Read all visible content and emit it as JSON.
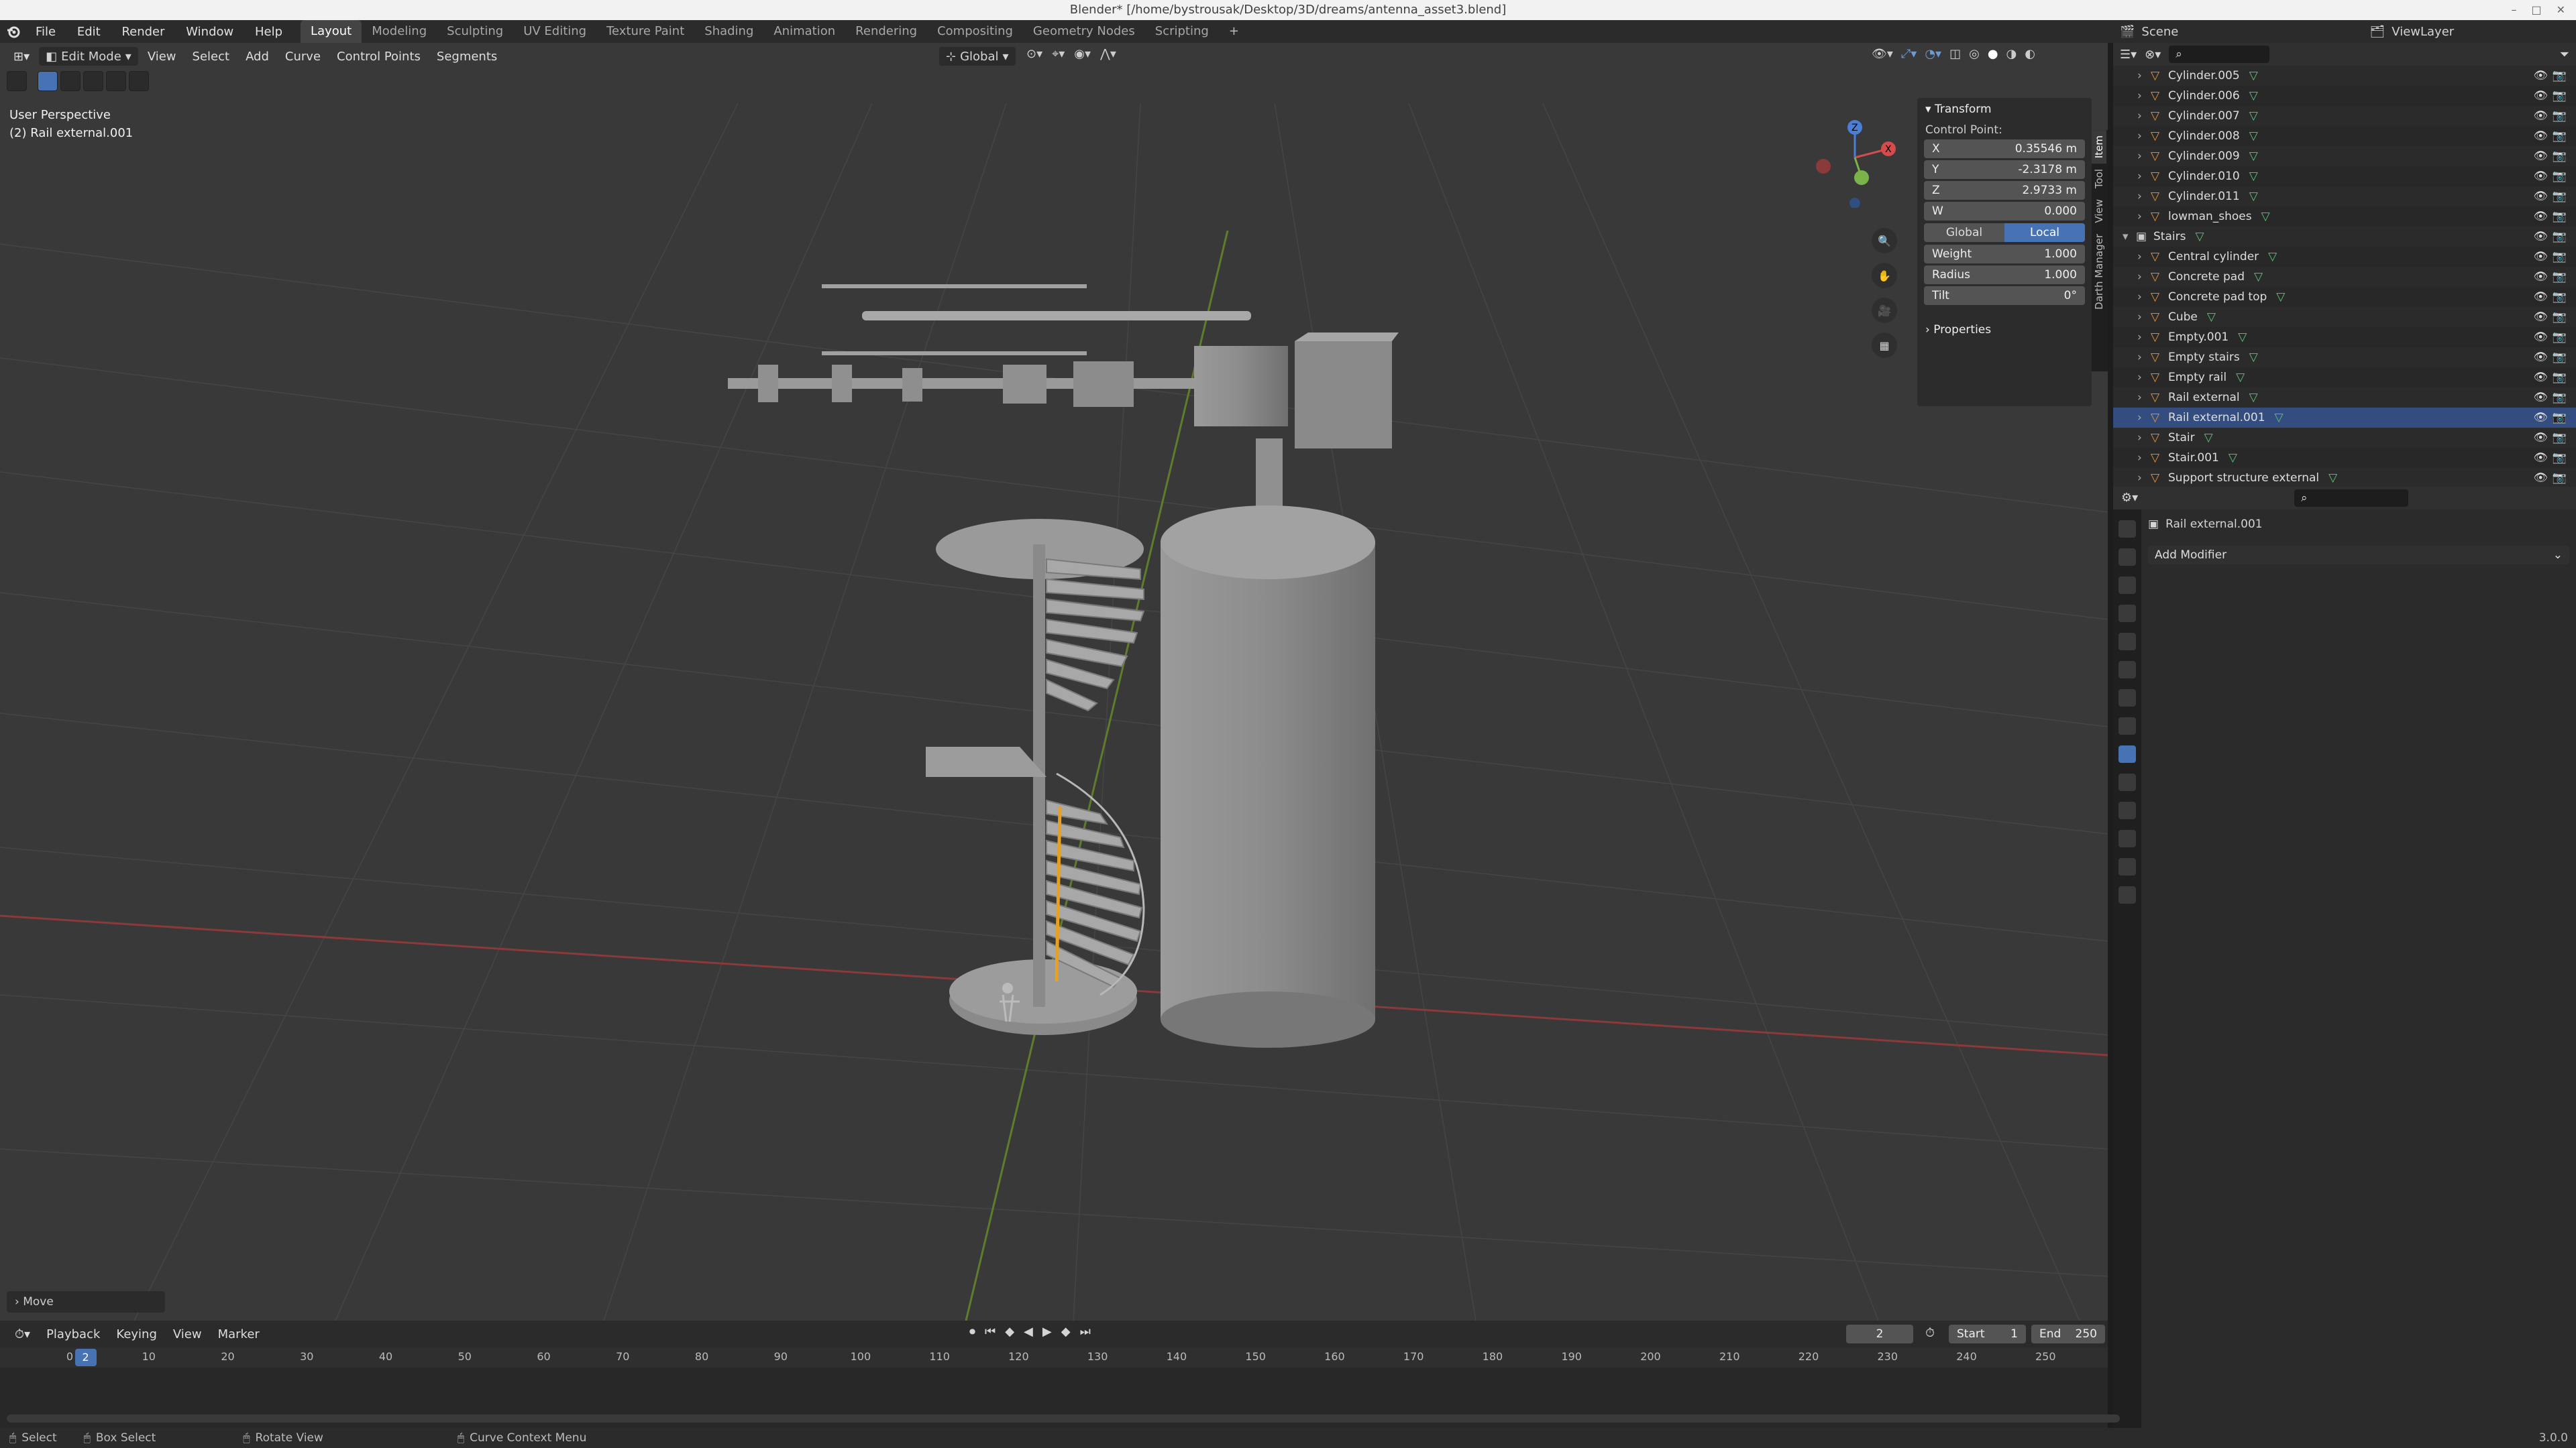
{
  "window": {
    "title": "Blender* [/home/bystrousak/Desktop/3D/dreams/antenna_asset3.blend]"
  },
  "menu": [
    "File",
    "Edit",
    "Render",
    "Window",
    "Help"
  ],
  "workspaces": [
    "Layout",
    "Modeling",
    "Sculpting",
    "UV Editing",
    "Texture Paint",
    "Shading",
    "Animation",
    "Rendering",
    "Compositing",
    "Geometry Nodes",
    "Scripting"
  ],
  "active_workspace": "Layout",
  "scene": {
    "label": "Scene",
    "view_layer": "ViewLayer"
  },
  "viewport": {
    "mode": "Edit Mode",
    "menus": [
      "View",
      "Select",
      "Add",
      "Curve",
      "Control Points",
      "Segments"
    ],
    "orientation": "Global",
    "perspective": "User Perspective",
    "active_object": "(2) Rail external.001",
    "last_op": "Move"
  },
  "npanel": {
    "section": "Transform",
    "subtitle": "Control Point:",
    "coords": [
      {
        "label": "X",
        "value": "0.35546 m"
      },
      {
        "label": "Y",
        "value": "-2.3178 m"
      },
      {
        "label": "Z",
        "value": "2.9733 m"
      },
      {
        "label": "W",
        "value": "0.000"
      }
    ],
    "space": [
      "Global",
      "Local"
    ],
    "active_space": "Local",
    "params": [
      {
        "label": "Weight",
        "value": "1.000"
      },
      {
        "label": "Radius",
        "value": "1.000"
      },
      {
        "label": "Tilt",
        "value": "0°"
      }
    ],
    "properties_label": "Properties",
    "tabs": [
      "Item",
      "Tool",
      "View",
      "Darth Manager"
    ]
  },
  "outliner": {
    "rows": [
      {
        "name": "Cylinder.005",
        "indent": 2
      },
      {
        "name": "Cylinder.006",
        "indent": 2
      },
      {
        "name": "Cylinder.007",
        "indent": 2
      },
      {
        "name": "Cylinder.008",
        "indent": 2
      },
      {
        "name": "Cylinder.009",
        "indent": 2
      },
      {
        "name": "Cylinder.010",
        "indent": 2
      },
      {
        "name": "Cylinder.011",
        "indent": 2
      },
      {
        "name": "lowman_shoes",
        "indent": 2
      },
      {
        "name": "Stairs",
        "indent": 1
      },
      {
        "name": "Central cylinder",
        "indent": 2
      },
      {
        "name": "Concrete pad",
        "indent": 2
      },
      {
        "name": "Concrete pad top",
        "indent": 2
      },
      {
        "name": "Cube",
        "indent": 2
      },
      {
        "name": "Empty.001",
        "indent": 2
      },
      {
        "name": "Empty stairs",
        "indent": 2
      },
      {
        "name": "Empty rail",
        "indent": 2
      },
      {
        "name": "Rail external",
        "indent": 2
      },
      {
        "name": "Rail external.001",
        "indent": 2,
        "selected": true
      },
      {
        "name": "Stair",
        "indent": 2
      },
      {
        "name": "Stair.001",
        "indent": 2
      },
      {
        "name": "Support structure external",
        "indent": 2
      }
    ]
  },
  "properties": {
    "object": "Rail external.001",
    "add_modifier": "Add Modifier"
  },
  "timeline": {
    "menus": [
      "Playback",
      "Keying",
      "View",
      "Marker"
    ],
    "current_frame": "2",
    "start_label": "Start",
    "start": "1",
    "end_label": "End",
    "end": "250",
    "ticks": [
      "0",
      "10",
      "20",
      "30",
      "40",
      "50",
      "60",
      "70",
      "80",
      "90",
      "100",
      "110",
      "120",
      "130",
      "140",
      "150",
      "160",
      "170",
      "180",
      "190",
      "200",
      "210",
      "220",
      "230",
      "240",
      "250"
    ]
  },
  "status": {
    "select": "Select",
    "box_select": "Box Select",
    "rotate": "Rotate View",
    "context": "Curve Context Menu",
    "version": "3.0.0"
  }
}
